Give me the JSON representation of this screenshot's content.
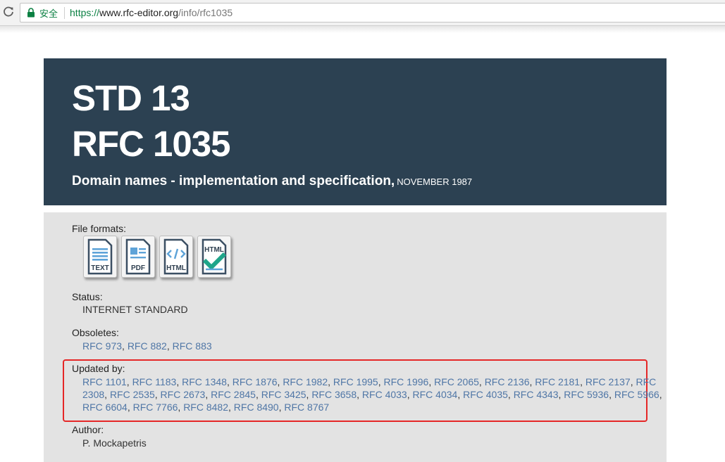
{
  "browser": {
    "secure_label": "安全",
    "url_scheme": "https://",
    "url_host": "www.rfc-editor.org",
    "url_path": "/info/rfc1035"
  },
  "header": {
    "std": "STD 13",
    "rfc": "RFC 1035",
    "title": "Domain names - implementation and specification,",
    "date": "NOVEMBER 1987"
  },
  "file_formats": {
    "label": "File formats:",
    "items": [
      {
        "label": "TEXT",
        "icon": "text-file-icon"
      },
      {
        "label": "PDF",
        "icon": "pdf-file-icon"
      },
      {
        "label": "HTML",
        "icon": "html-file-icon"
      },
      {
        "label": "HTML",
        "icon": "html-checked-file-icon"
      }
    ]
  },
  "status": {
    "label": "Status:",
    "value": "INTERNET STANDARD"
  },
  "obsoletes": {
    "label": "Obsoletes:",
    "items": [
      "RFC 973",
      "RFC 882",
      "RFC 883"
    ]
  },
  "updated_by": {
    "label": "Updated by:",
    "lines": [
      [
        "RFC 1101",
        "RFC 1183",
        "RFC 1348",
        "RFC 1876",
        "RFC 1982",
        "RFC 1995",
        "RFC 1996",
        "RFC 2065",
        "RFC 2136",
        "RFC 2181",
        "RFC 2137",
        "RFC"
      ],
      [
        "2308",
        "RFC 2535",
        "RFC 2673",
        "RFC 2845",
        "RFC 3425",
        "RFC 3658",
        "RFC 4033",
        "RFC 4034",
        "RFC 4035",
        "RFC 4343",
        "RFC 5936",
        "RFC 5966"
      ],
      [
        "RFC 6604",
        "RFC 7766",
        "RFC 8482",
        "RFC 8490",
        "RFC 8767"
      ]
    ]
  },
  "author": {
    "label": "Author:",
    "value": "P. Mockapetris"
  },
  "colors": {
    "hero_bg": "#2c4152",
    "panel_bg": "#e3e3e3",
    "link": "#4f76a6",
    "highlight_box": "#e52727",
    "secure_green": "#0b8043"
  }
}
